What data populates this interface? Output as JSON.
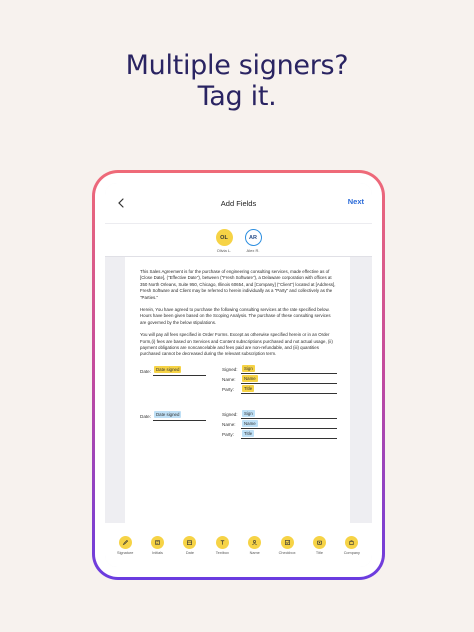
{
  "headline": {
    "line1": "Multiple signers?",
    "line2": "Tag it."
  },
  "app": {
    "title": "Add Fields",
    "next_label": "Next"
  },
  "signers": [
    {
      "initials": "OL",
      "name": "Olivia L."
    },
    {
      "initials": "AR",
      "name": "Alex R."
    }
  ],
  "document": {
    "paragraphs": [
      "This Sales Agreement is for the purchase of engineering consulting services, made effective as of [Close Date], (\"Effective Date\"), between (\"Fresh Software\"), a Delaware corporation with offices at 350 North Orleans, Suite 950, Chicago, Illinois 60654, and [Company] (\"Client\") located at [Address], Fresh Software and Client may be referred to herein individually as a \"Party\" and collectively as the \"Parties.\"",
      "Herein, You have agreed to purchase the following consulting services at the rate specified below. Hours have been given based on the Scoping Analysis. The purchase of these consulting services are governed by the below stipulations.",
      "You will pay all fees specified in Order Forms. Except as otherwise specified herein or in an Order Form,(i) fees are based on Services and Content subscriptions purchased and not actual usage, (ii) payment obligations are noncancelable and fees paid are non-refundable, and (iii) quantities purchased cannot be decreased during the relevant subscription term."
    ],
    "signature_blocks": [
      {
        "date_label": "Date:",
        "date_tag": "Date signed",
        "signed_label": "Signed:",
        "sign_tag": "Sign",
        "name_label": "Name:",
        "name_tag": "Name",
        "party_label": "Party:",
        "title_tag": "Title"
      },
      {
        "date_label": "Date:",
        "date_tag": "Date signed",
        "signed_label": "Signed:",
        "sign_tag": "Sign",
        "name_label": "Name:",
        "name_tag": "Name",
        "party_label": "Party:",
        "title_tag": "Title"
      }
    ]
  },
  "toolbar": [
    {
      "label": "Signature",
      "icon": "pen-icon"
    },
    {
      "label": "Initials",
      "icon": "initials-icon"
    },
    {
      "label": "Date",
      "icon": "calendar-icon"
    },
    {
      "label": "Textbox",
      "icon": "text-icon"
    },
    {
      "label": "Name",
      "icon": "person-icon"
    },
    {
      "label": "Checkbox",
      "icon": "checkbox-icon"
    },
    {
      "label": "Title",
      "icon": "title-icon"
    },
    {
      "label": "Company",
      "icon": "company-icon"
    }
  ],
  "colors": {
    "signer1": "#f6d346",
    "signer2": "#bfe0f6",
    "accent": "#2a6ad8",
    "headline": "#2a2462"
  }
}
